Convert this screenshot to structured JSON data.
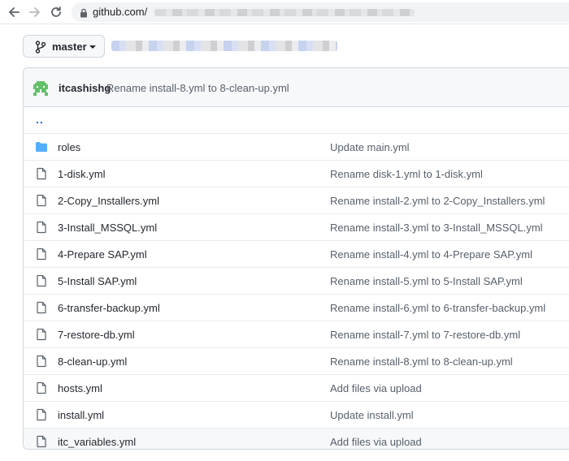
{
  "browser": {
    "url": "github.com/",
    "icons": {
      "back": "back-arrow-icon",
      "forward": "forward-arrow-icon",
      "reload": "reload-icon",
      "lock": "lock-icon"
    }
  },
  "branch": {
    "label": "master",
    "icon": "git-branch-icon"
  },
  "commit": {
    "author": "itcashishg",
    "message": "Rename install-8.yml to 8-clean-up.yml",
    "avatar_color": "#63c16a"
  },
  "parent_link": "..",
  "files": [
    {
      "type": "dir",
      "name": "roles",
      "message": "Update main.yml"
    },
    {
      "type": "file",
      "name": "1-disk.yml",
      "message": "Rename disk-1.yml to 1-disk.yml"
    },
    {
      "type": "file",
      "name": "2-Copy_Installers.yml",
      "message": "Rename install-2.yml to 2-Copy_Installers.yml"
    },
    {
      "type": "file",
      "name": "3-Install_MSSQL.yml",
      "message": "Rename install-3.yml to 3-Install_MSSQL.yml"
    },
    {
      "type": "file",
      "name": "4-Prepare SAP.yml",
      "message": "Rename install-4.yml to 4-Prepare SAP.yml"
    },
    {
      "type": "file",
      "name": "5-Install SAP.yml",
      "message": "Rename install-5.yml to 5-Install SAP.yml"
    },
    {
      "type": "file",
      "name": "6-transfer-backup.yml",
      "message": "Rename install-6.yml to 6-transfer-backup.yml"
    },
    {
      "type": "file",
      "name": "7-restore-db.yml",
      "message": "Rename install-7.yml to 7-restore-db.yml"
    },
    {
      "type": "file",
      "name": "8-clean-up.yml",
      "message": "Rename install-8.yml to 8-clean-up.yml"
    },
    {
      "type": "file",
      "name": "hosts.yml",
      "message": "Add files via upload"
    },
    {
      "type": "file",
      "name": "install.yml",
      "message": "Update install.yml"
    },
    {
      "type": "file",
      "name": "itc_variables.yml",
      "message": "Add files via upload"
    }
  ],
  "colors": {
    "folder": "#54aeff",
    "link": "#0969da",
    "file_icon": "#57606a",
    "header_bg": "#f6f8fa",
    "border": "#d0d7de"
  }
}
